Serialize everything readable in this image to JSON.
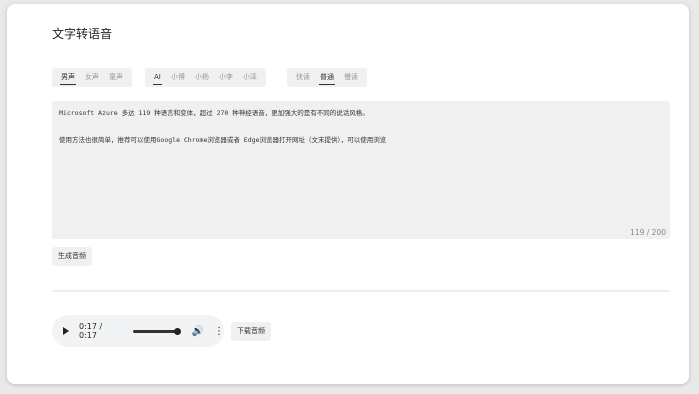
{
  "page": {
    "title": "文字转语音"
  },
  "gender_options": [
    {
      "label": "男声",
      "active": true
    },
    {
      "label": "女声",
      "active": false
    },
    {
      "label": "童声",
      "active": false
    }
  ],
  "voice_options": [
    {
      "label": "AI",
      "active": true
    },
    {
      "label": "小博",
      "active": false
    },
    {
      "label": "小杨",
      "active": false
    },
    {
      "label": "小李",
      "active": false
    },
    {
      "label": "小泽",
      "active": false
    }
  ],
  "speed_options": [
    {
      "label": "快读",
      "active": false
    },
    {
      "label": "普通",
      "active": true
    },
    {
      "label": "慢读",
      "active": false
    }
  ],
  "input": {
    "text": "Microsoft Azure 多达 119 种语言和变体，超过 270 种神经语音，更加强大的是有不同的说话风格。\n\n使用方法也很简单，推荐可以使用Google Chrome浏览器或者 Edge浏览器打开网址（文末提供），可以使用浏览",
    "counter": "119 / 200"
  },
  "actions": {
    "generate_label": "生成音频",
    "download_label": "下载音频"
  },
  "audio": {
    "time": "0:17 / 0:17",
    "progress": 1.0
  }
}
